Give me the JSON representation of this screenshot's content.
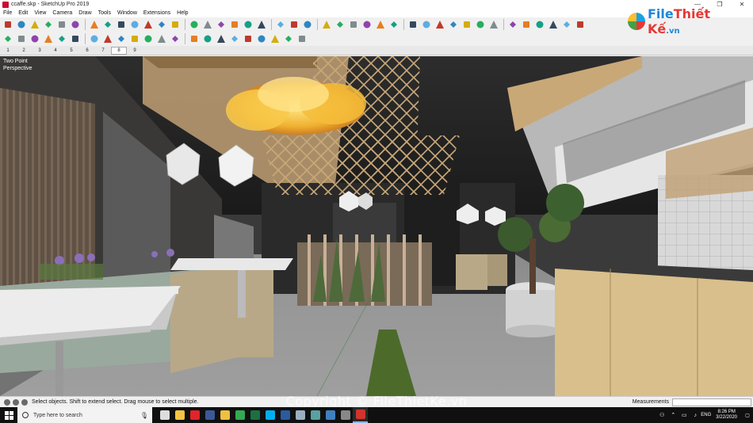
{
  "window": {
    "title": "ccaffe.skp - SketchUp Pro 2019",
    "controls": {
      "minimize": "—",
      "maximize": "❐",
      "close": "✕"
    }
  },
  "menu": [
    "File",
    "Edit",
    "View",
    "Camera",
    "Draw",
    "Tools",
    "Window",
    "Extensions",
    "Help"
  ],
  "toolbar_primary": [
    "select-icon",
    "eraser-icon",
    "pencil-icon",
    "arc-icon",
    "rectangle-icon",
    "push-pull-icon",
    "move-icon",
    "rotate-icon",
    "offset-icon",
    "paint-bucket-icon",
    "tape-measure-icon",
    "text-icon",
    "axes-icon",
    "3d-text-icon",
    "orbit-icon",
    "pan-icon",
    "zoom-icon",
    "zoom-extents-icon",
    "warehouse-icon",
    "extension-icon",
    "ruby-icon",
    "user-icon",
    "styles-icon",
    "wireframe-icon",
    "hidden-line-icon",
    "shaded-icon",
    "textured-icon",
    "monochrome-icon",
    "iso-view-icon",
    "top-view-icon",
    "front-view-icon",
    "right-view-icon",
    "back-view-icon",
    "left-view-icon",
    "section-icon",
    "walk-icon",
    "position-camera-icon",
    "look-around-icon",
    "sandbox-icon",
    "flip-icon",
    "align-icon"
  ],
  "toolbar_secondary": [
    "component-icon",
    "play-icon",
    "stop-icon",
    "record-icon",
    "scene-icon",
    "settings-icon",
    "move-solid-icon",
    "scale-icon",
    "union-icon",
    "subtract-icon",
    "intersect-icon",
    "trim-icon",
    "split-icon",
    "solid-icon",
    "render-icon",
    "light-icon",
    "material-icon",
    "vray-icon",
    "texture-icon",
    "camera-icon",
    "frame-icon",
    "batch-icon"
  ],
  "scenes": [
    "1",
    "2",
    "3",
    "4",
    "5",
    "6",
    "7",
    "8",
    "9"
  ],
  "active_scene": "8",
  "viewport": {
    "label_line1": "Two Point",
    "label_line2": "Perspective"
  },
  "logo": {
    "prefix": "File",
    "suffix": "Thiết Kế",
    "tld": ".vn"
  },
  "watermark": "Copyright © FileThietKe.vn",
  "status": {
    "message": "Select objects. Shift to extend select. Drag mouse to select multiple.",
    "measurements_label": "Measurements",
    "measurements_value": ""
  },
  "taskbar": {
    "search_placeholder": "Type here to search",
    "apps": [
      {
        "name": "task-view-icon",
        "color": "#dddddd"
      },
      {
        "name": "file-explorer-icon",
        "color": "#f4c542"
      },
      {
        "name": "opera-icon",
        "color": "#e0242a"
      },
      {
        "name": "facebook-icon",
        "color": "#3b5998"
      },
      {
        "name": "folder-icon",
        "color": "#f0c040"
      },
      {
        "name": "chrome-icon",
        "color": "#34a853"
      },
      {
        "name": "excel-icon",
        "color": "#1d6f42"
      },
      {
        "name": "skype-icon",
        "color": "#00aff0"
      },
      {
        "name": "photoshop-icon",
        "color": "#2c5a9e"
      },
      {
        "name": "image-app-icon",
        "color": "#9ab0c0"
      },
      {
        "name": "map-app-icon",
        "color": "#5aa0a0"
      },
      {
        "name": "layout-icon",
        "color": "#4080c0"
      },
      {
        "name": "calculator-icon",
        "color": "#888888"
      },
      {
        "name": "sketchup-icon",
        "color": "#d0342c"
      }
    ],
    "active_app": 13,
    "language": "ENG",
    "time": "8:26 PM",
    "date": "3/22/2020"
  }
}
